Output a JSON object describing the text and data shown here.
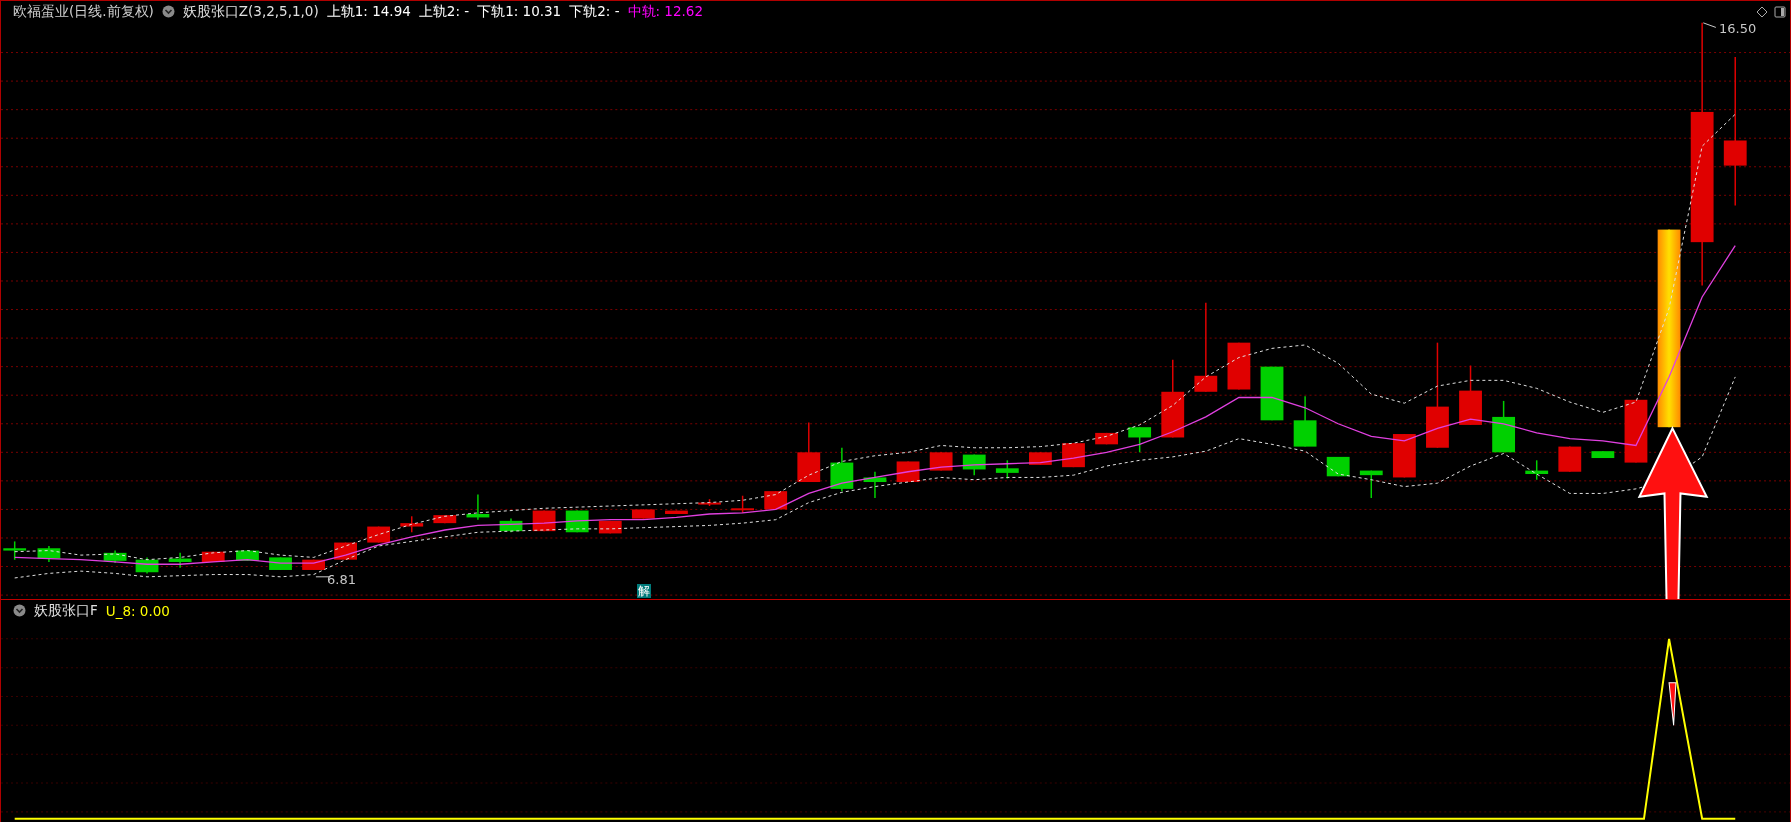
{
  "main_chart": {
    "title": "欧福蛋业(日线.前复权)",
    "indicator": {
      "name": "妖股张口Z(3,2,5,1,0)",
      "values": [
        {
          "label": "上轨1: 14.94",
          "color": "#ffffff"
        },
        {
          "label": "上轨2: -",
          "color": "#ffffff"
        },
        {
          "label": "下轨1: 10.31",
          "color": "#ffffff"
        },
        {
          "label": "下轨2: -",
          "color": "#ffffff"
        },
        {
          "label": "中轨: 12.62",
          "color": "#ff00ff"
        }
      ]
    },
    "high_label": "16.50",
    "low_label": "6.81",
    "marker": "解"
  },
  "sub_chart": {
    "indicator": {
      "name": "妖股张口F",
      "value": "U_8: 0.00"
    }
  }
}
